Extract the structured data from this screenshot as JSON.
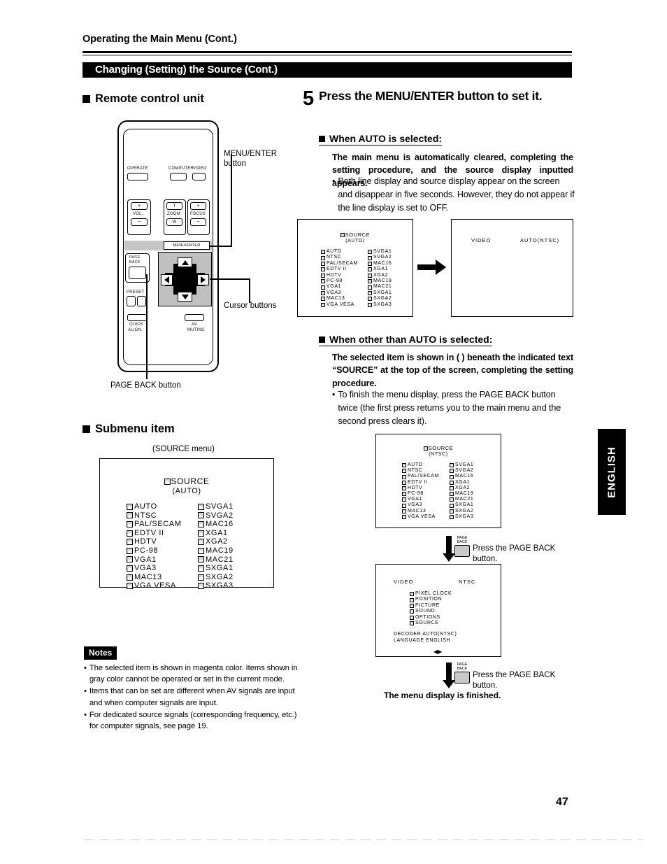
{
  "header": {
    "running_head": "Operating the Main Menu (Cont.)",
    "section_title": "Changing (Setting) the Source (Cont.)"
  },
  "left_column": {
    "remote_heading": "Remote control unit",
    "submenu_heading": "Submenu item",
    "submenu_caption": "(SOURCE menu)",
    "callouts": {
      "menu_enter": "MENU/ENTER\nbutton",
      "menu_enter_line1": "MENU/ENTER",
      "menu_enter_line2": "button",
      "cursor": "Cursor buttons",
      "page_back": "PAGE BACK button"
    },
    "remote": {
      "operate": "OPERATE",
      "computer": "COMPUTER",
      "video": "VIDEO",
      "vol": "VOL.",
      "zoom": "ZOOM",
      "zoom_t": "T",
      "zoom_w": "W",
      "focus": "FOCUS",
      "plus": "+",
      "minus": "−",
      "page_back_l1": "PAGE",
      "page_back_l2": "BACK",
      "preset": "PRESET",
      "menu_enter": "MENU/ENTER",
      "quick_align_l1": "QUICK",
      "quick_align_l2": "ALIGN.",
      "av_muting_l1": "AV",
      "av_muting_l2": "MUTING"
    }
  },
  "notes": {
    "label": "Notes",
    "items": [
      "The selected item is shown in magenta color. Items shown in gray color cannot be operated or set in the current mode.",
      "Items that can be set are different when AV signals are input and when computer signals are input.",
      "For dedicated source signals (corresponding frequency, etc.) for computer signals, see page 19."
    ]
  },
  "step5": {
    "number": "5",
    "text": "Press the MENU/ENTER button to set it."
  },
  "auto_section": {
    "heading": "When AUTO is selected:",
    "paragraph": "The main menu is automatically cleared, completing the setting procedure, and the source display inputted appears.",
    "bullet": "Both line display and source display appear on the screen and disappear in five seconds. However, they do not appear if the line display is set to OFF."
  },
  "other_section": {
    "heading": "When other than AUTO is selected:",
    "paragraph": "The selected item is shown in (  ) beneath the indicated text “SOURCE” at the top of the screen, completing the setting procedure.",
    "bullet": "To finish the menu display, press the PAGE BACK button twice (the first press returns you to the main menu and the second press clears it)."
  },
  "osd": {
    "source_title": "SOURCE",
    "mode_auto": "(AUTO)",
    "mode_ntsc": "(NTSC)",
    "column_left": [
      "AUTO",
      "NTSC",
      "PAL/SECAM",
      "EDTV II",
      "HDTV",
      "PC-98",
      "VGA1",
      "VGA3",
      "MAC13",
      "VGA VESA"
    ],
    "column_right": [
      "SVGA1",
      "SVGA2",
      "MAC16",
      "XGA1",
      "XGA2",
      "MAC19",
      "MAC21",
      "SXGA1",
      "SXGA2",
      "SXGA3"
    ],
    "display_screen": {
      "line": "VIDEO",
      "source": "AUTO(NTSC)"
    },
    "main_menu": {
      "line": "VIDEO",
      "source": "NTSC",
      "items": [
        "PIXEL CLOCK",
        "POSITION",
        "PICTURE",
        "SOUND",
        "OPTIONS",
        "SOURCE"
      ],
      "decoder": "DECODER AUTO(NTSC)",
      "language": "LANGUAGE ENGLISH"
    }
  },
  "flow": {
    "page_back_icon_l1": "PAGE",
    "page_back_icon_l2": "BACK",
    "press_page_back_l1": "Press the PAGE BACK",
    "press_page_back_l2": "button.",
    "finished": "The menu display is finished."
  },
  "footer": {
    "side_tab": "ENGLISH",
    "page_number": "47"
  }
}
